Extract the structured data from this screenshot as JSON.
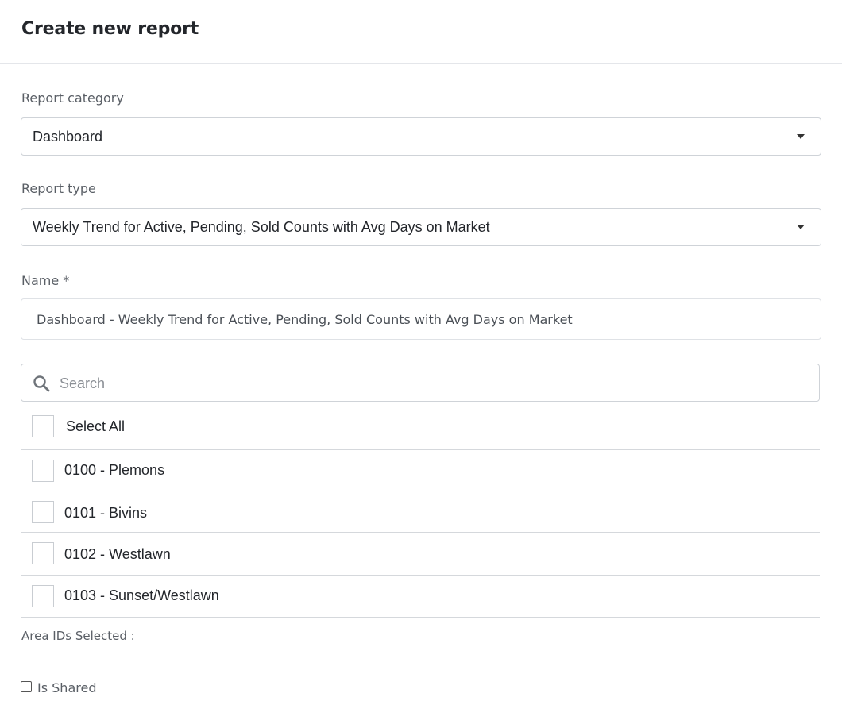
{
  "dialog": {
    "title": "Create new report"
  },
  "form": {
    "category": {
      "label": "Report category",
      "value": "Dashboard"
    },
    "type": {
      "label": "Report type",
      "value": "Weekly Trend for Active, Pending, Sold Counts with Avg Days on Market"
    },
    "name": {
      "label": "Name *",
      "value": "Dashboard - Weekly Trend for Active, Pending, Sold Counts with Avg Days on Market"
    },
    "search": {
      "placeholder": "Search",
      "icon": "search-icon"
    },
    "select_all": {
      "label": "Select All",
      "checked": false
    },
    "areas": [
      {
        "label": "0100 - Plemons",
        "checked": false
      },
      {
        "label": "0101 - Bivins",
        "checked": false
      },
      {
        "label": "0102 - Westlawn",
        "checked": false
      },
      {
        "label": "0103 - Sunset/Westlawn",
        "checked": false
      }
    ],
    "area_ids_selected_label": "Area IDs Selected :",
    "is_shared": {
      "label": "Is Shared",
      "checked": false
    }
  }
}
